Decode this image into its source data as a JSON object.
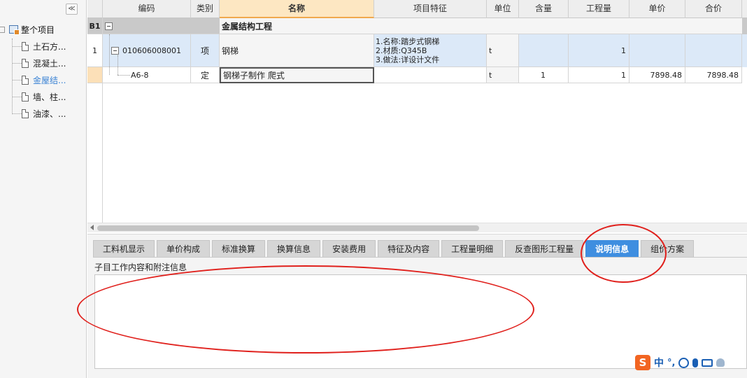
{
  "sidebar": {
    "collapse_glyph": "≪",
    "root_label": "整个项目",
    "items": [
      {
        "label": "土石方...",
        "icon": "doc-icon"
      },
      {
        "label": "混凝土...",
        "icon": "doc-icon"
      },
      {
        "label": "金屋结...",
        "icon": "doc-icon",
        "active": true
      },
      {
        "label": "墙、柱...",
        "icon": "doc-icon"
      },
      {
        "label": "油漆、...",
        "icon": "doc-icon"
      }
    ]
  },
  "grid": {
    "columns": [
      "编码",
      "类别",
      "名称",
      "项目特征",
      "单位",
      "含量",
      "工程量",
      "单价",
      "合价"
    ],
    "section": {
      "tag": "B1",
      "title": "金属结构工程"
    },
    "rows": [
      {
        "no": "1",
        "code": "010606008001",
        "category": "项",
        "name": "钢梯",
        "features": "1.名称:踏步式钢梯\n2.材质:Q345B\n3.做法:详设计文件",
        "unit": "t",
        "content": "",
        "quantity": "1",
        "unit_price": "",
        "total": ""
      },
      {
        "no": "",
        "code": "A6-8",
        "category": "定",
        "name": "钢梯子制作 爬式",
        "features": "",
        "unit": "t",
        "content": "1",
        "quantity": "1",
        "unit_price": "7898.48",
        "total": "7898.48"
      }
    ]
  },
  "bottom": {
    "tabs": [
      "工料机显示",
      "单价构成",
      "标准换算",
      "换算信息",
      "安装费用",
      "特征及内容",
      "工程量明细",
      "反查图形工程量",
      "说明信息",
      "组价方案"
    ],
    "active_tab": "说明信息",
    "description_label": "子目工作内容和附注信息",
    "description_text": ""
  },
  "ime": {
    "logo": "S",
    "lang": "中",
    "punct": "°,"
  },
  "colors": {
    "accent": "#3e8ee0",
    "annotation": "#e0201c",
    "row_selected": "#dce9f8",
    "header_selected": "#fde7c2"
  }
}
